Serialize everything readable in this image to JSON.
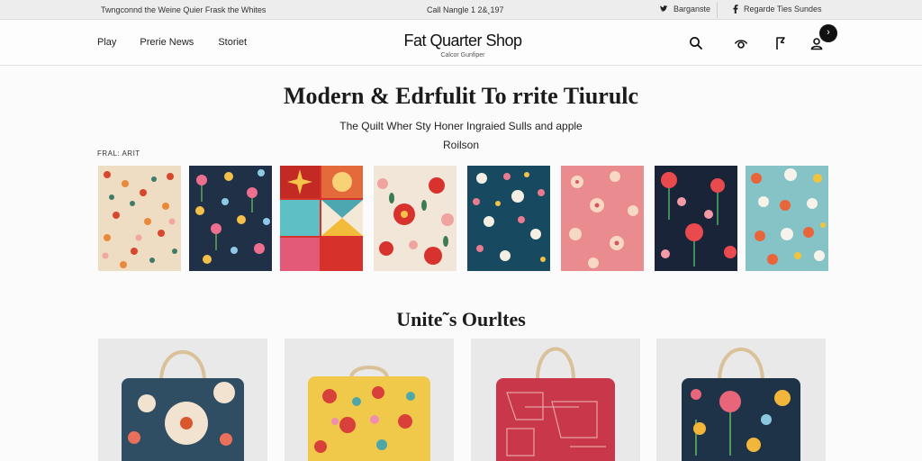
{
  "topbar": {
    "promo": "Twngconnd the Weine Quier Frask the Whites",
    "phone": "Call Nangle 1 2&¸197",
    "twitter_label": "Barganste",
    "facebook_label": "Regarde  Ties Sundes",
    "twitter_icon": "twitter-icon",
    "facebook_icon": "facebook-icon"
  },
  "header": {
    "nav": [
      "Play",
      "Prerie News",
      "Storiet"
    ],
    "logo": "Fat Quarter Shop",
    "tagline": "Calcor Gunfiper",
    "badge": "›",
    "icons": [
      "search-icon",
      "eye-icon",
      "flag-icon",
      "account-icon"
    ]
  },
  "hero": {
    "title": "Modern & Edrfulit To rrite Tiurulc",
    "subtitle": "The Quilt Wher Sty Honer Ingraied Sulls and apple Roilson",
    "fabric_label": "FRAL: ARIT"
  },
  "swatches": [
    {
      "name": "cream-ditsy-floral",
      "bg": "#eedcc3"
    },
    {
      "name": "navy-flower-garden",
      "bg": "#1f3047"
    },
    {
      "name": "red-geometric-patchwork",
      "bg": "#d6322b"
    },
    {
      "name": "cream-red-blooms",
      "bg": "#f1e6d8"
    },
    {
      "name": "teal-white-floral",
      "bg": "#174a60"
    },
    {
      "name": "pink-blossom",
      "bg": "#ea8b90"
    },
    {
      "name": "navy-poppy",
      "bg": "#1a2438"
    },
    {
      "name": "aqua-sunflower",
      "bg": "#86c3c6"
    }
  ],
  "section": {
    "title": "Unite˜s Ourltes"
  },
  "products": [
    {
      "name": "blue-floral-tote",
      "bg": "#2f4d63"
    },
    {
      "name": "yellow-floral-tote",
      "bg": "#f1c94a"
    },
    {
      "name": "red-print-tote",
      "bg": "#c9374a"
    },
    {
      "name": "navy-floral-tote",
      "bg": "#1f3348"
    }
  ],
  "colors": {
    "topbar_bg": "#ededed",
    "page_bg": "#fbfbfb",
    "text": "#222222"
  }
}
